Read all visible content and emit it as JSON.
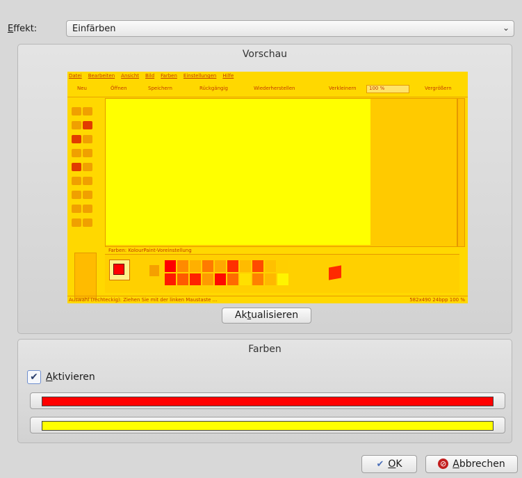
{
  "effect": {
    "label_prefix": "E",
    "label_rest": "ffekt:",
    "selected": "Einfärben",
    "arrow": "⌄"
  },
  "preview": {
    "title": "Vorschau",
    "refresh_before": "Ak",
    "refresh_mnemonic": "t",
    "refresh_after": "ualisieren",
    "screenshot": {
      "menu": [
        "Datei",
        "Bearbeiten",
        "Ansicht",
        "Bild",
        "Farben",
        "Einstellungen",
        "Hilfe"
      ],
      "toolbar": [
        "Neu",
        "Öffnen",
        "Speichern",
        "Rückgängig",
        "Wiederherstellen",
        "Verkleinern",
        "100 %",
        "Vergrößern"
      ],
      "color_bar_title": "Farben: KolourPaint-Voreinstellung",
      "status_left": "Auswahl (rechteckig): Ziehen Sie mit der linken Maustaste ...",
      "status_right": "582x490    24bpp   100 %"
    }
  },
  "colors": {
    "title": "Farben",
    "activate_mnemonic": "A",
    "activate_rest": "ktivieren",
    "checked": true,
    "color_1": "#ff0000",
    "color_2": "#ffff00"
  },
  "buttons": {
    "ok_mnemonic": "O",
    "ok_rest": "K",
    "cancel_mnemonic": "A",
    "cancel_rest": "bbrechen"
  }
}
